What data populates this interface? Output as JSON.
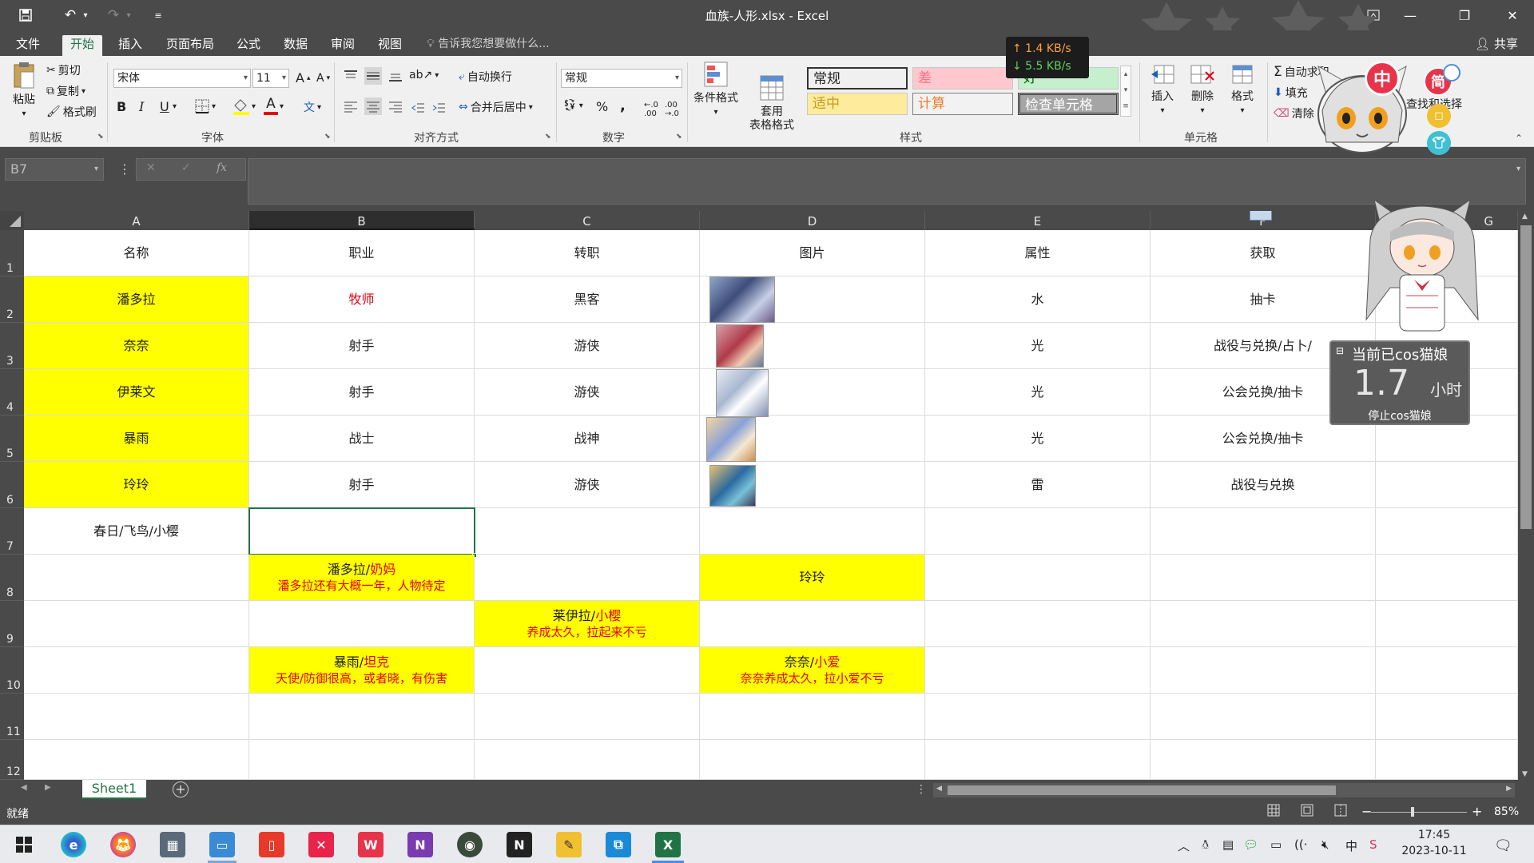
{
  "window": {
    "title": "血族-人形.xlsx - Excel",
    "share_label": "共享"
  },
  "tabs": [
    "文件",
    "开始",
    "插入",
    "页面布局",
    "公式",
    "数据",
    "审阅",
    "视图"
  ],
  "tell_me": "告诉我您想要做什么...",
  "ribbon": {
    "clipboard": {
      "label": "剪贴板",
      "paste": "粘贴",
      "cut": "剪切",
      "copy": "复制",
      "format_painter": "格式刷"
    },
    "font": {
      "label": "字体",
      "name": "宋体",
      "size": "11",
      "bold": "B",
      "italic": "I",
      "underline": "U",
      "font_color_glyph": "A",
      "grow": "A",
      "shrink": "A"
    },
    "alignment": {
      "label": "对齐方式",
      "wrap": "自动换行",
      "merge": "合并后居中"
    },
    "number": {
      "label": "数字",
      "format": "常规",
      "percent": "%",
      "comma": ","
    },
    "styles": {
      "label": "样式",
      "conditional": "条件格式",
      "table_format": "套用\n表格格式",
      "cells": [
        {
          "text": "常规",
          "bg": "#ffffff",
          "fg": "#000000"
        },
        {
          "text": "差",
          "bg": "#ffc7ce",
          "fg": "#ff6f7d"
        },
        {
          "text": "好",
          "bg": "#c6efce",
          "fg": "#006100"
        },
        {
          "text": "适中",
          "bg": "#ffeb9c",
          "fg": "#c29b1f"
        },
        {
          "text": "计算",
          "bg": "#f2f2f2",
          "fg": "#f07b2a"
        },
        {
          "text": "检查单元格",
          "bg": "#a5a5a5",
          "fg": "#ffffff"
        }
      ]
    },
    "cells": {
      "label": "单元格",
      "insert": "插入",
      "delete": "删除",
      "format": "格式"
    },
    "editing": {
      "autosum": "自动求和",
      "fill": "填充",
      "clear": "清除",
      "find": "查找和选择"
    }
  },
  "name_box": "B7",
  "fx": "fx",
  "columns": [
    "A",
    "B",
    "C",
    "D",
    "E",
    "F",
    "G"
  ],
  "rows": [
    "1",
    "2",
    "3",
    "4",
    "5",
    "6",
    "7",
    "8",
    "9",
    "10",
    "11",
    "12"
  ],
  "table": {
    "header": [
      "名称",
      "职业",
      "转职",
      "图片",
      "属性",
      "获取"
    ],
    "data": [
      {
        "name": "潘多拉",
        "job": "牧师",
        "promo": "黑客",
        "attr": "水",
        "obtain": "抽卡"
      },
      {
        "name": "奈奈",
        "job": "射手",
        "promo": "游侠",
        "attr": "光",
        "obtain": "战役与兑换/占卜/"
      },
      {
        "name": "伊莱文",
        "job": "射手",
        "promo": "游侠",
        "attr": "光",
        "obtain": "公会兑换/抽卡"
      },
      {
        "name": "暴雨",
        "job": "战士",
        "promo": "战神",
        "attr": "光",
        "obtain": "公会兑换/抽卡"
      },
      {
        "name": "玲玲",
        "job": "射手",
        "promo": "游侠",
        "attr": "雷",
        "obtain": "战役与兑换"
      }
    ],
    "row7_a": "春日/飞鸟/小樱",
    "notes": {
      "b8_main": "潘多拉/",
      "b8_red": "奶妈",
      "b8_line2": "潘多拉还有大概一年，人物待定",
      "d8": "玲玲",
      "c9_main": "莱伊拉/",
      "c9_red": "小樱",
      "c9_line2": "养成太久，拉起来不亏",
      "b10_main": "暴雨/",
      "b10_red": "坦克",
      "b10_line2": "天使/防御很高，或者晓，有伤害",
      "d10_main": "奈奈/",
      "d10_red": "小爱",
      "d10_line2": "奈奈养成太久，拉小爱不亏"
    }
  },
  "sheet": {
    "tab": "Sheet1",
    "add": "+"
  },
  "status": {
    "ready": "就绪",
    "zoom": "85%"
  },
  "overlay": {
    "net_up": "↑ 1.4 KB/s",
    "net_down": "↓ 5.5 KB/s",
    "cos_title": "当前已cos猫娘",
    "cos_value": "1.7",
    "cos_unit": "小时",
    "cos_stop": "停止cos猫娘",
    "ime_zh": "中",
    "ime_simp": "简"
  },
  "taskbar": {
    "time": "17:45",
    "date": "2023-10-11",
    "ime": "中",
    "onenote": "N",
    "notion": "N"
  }
}
